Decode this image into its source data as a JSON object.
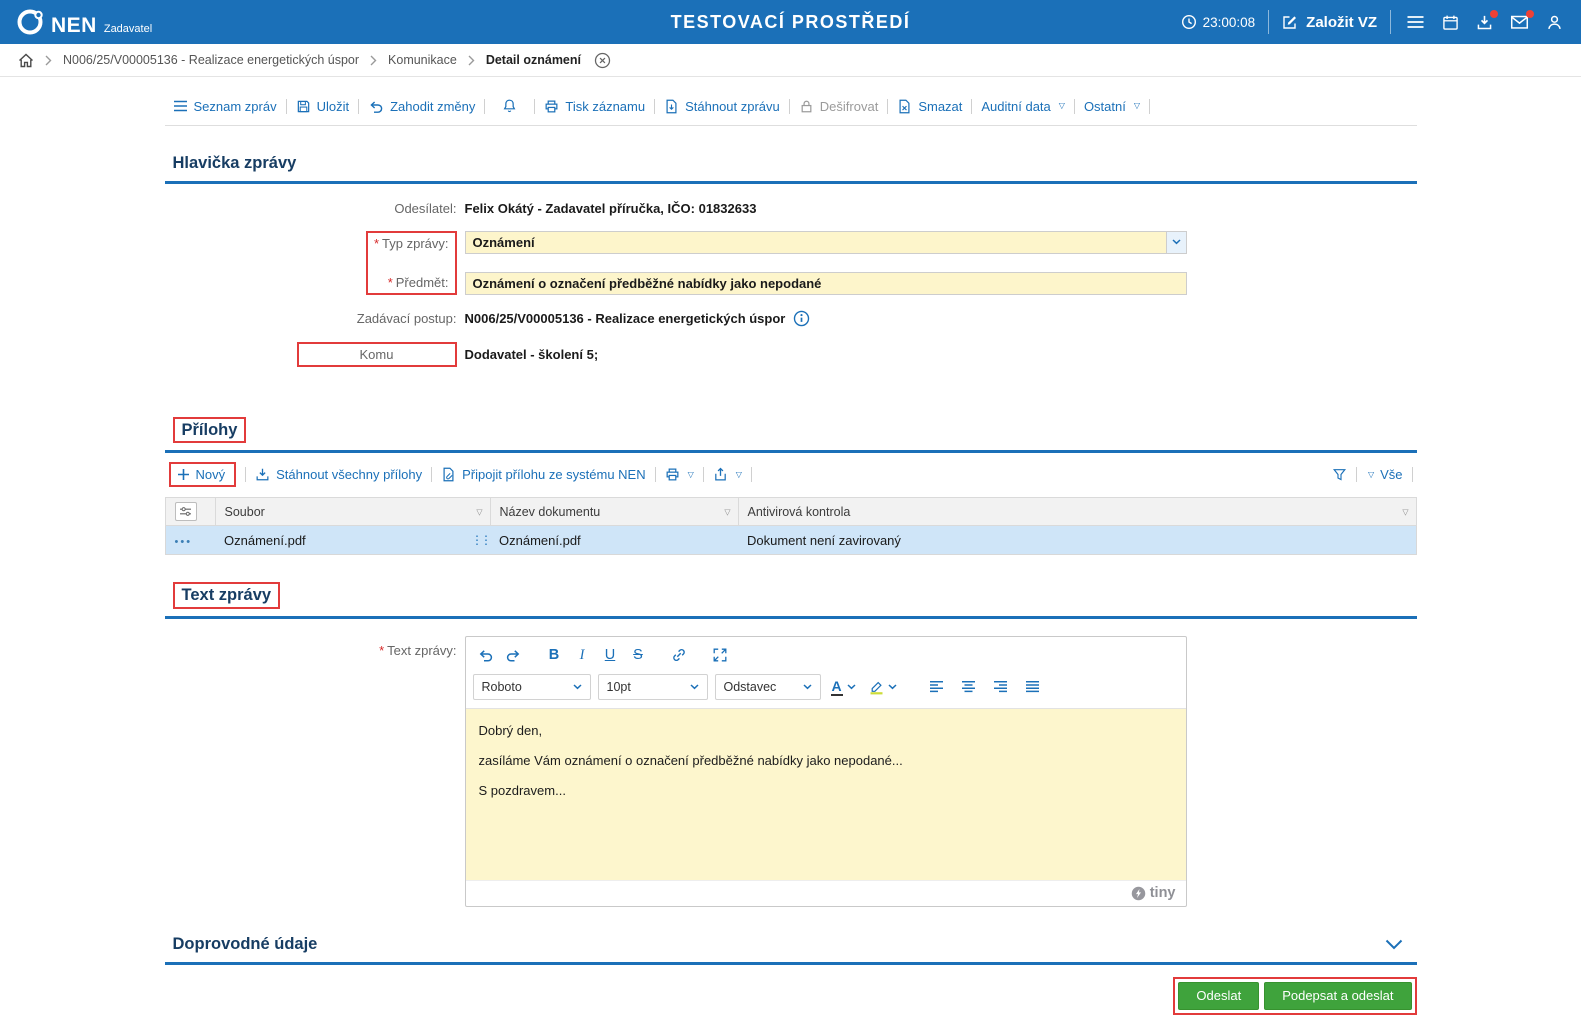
{
  "header": {
    "app_name": "NEN",
    "app_role": "Zadavatel",
    "env_title": "TESTOVACÍ PROSTŘEDÍ",
    "time": "23:00:08",
    "new_vz_label": "Založit VZ"
  },
  "breadcrumb": {
    "items": [
      "N006/25/V00005136 - Realizace energetických úspor",
      "Komunikace",
      "Detail oznámení"
    ]
  },
  "toolbar": {
    "seznam_zprav": "Seznam zpráv",
    "ulozit": "Uložit",
    "zahodit_zmeny": "Zahodit změny",
    "tisk_zaznamu": "Tisk záznamu",
    "stahnout_zpravu": "Stáhnout zprávu",
    "desifrovat": "Dešifrovat",
    "smazat": "Smazat",
    "auditni_data": "Auditní data",
    "ostatni": "Ostatní"
  },
  "required_mark": "*",
  "message_header": {
    "section_title": "Hlavička zprávy",
    "sender_label": "Odesílatel:",
    "sender_value": "Felix Okátý - Zadavatel příručka, IČO: 01832633",
    "type_label": "Typ zprávy:",
    "type_value": "Oznámení",
    "subject_label": "Předmět:",
    "subject_value": "Oznámení o označení předběžné nabídky jako nepodané",
    "procedure_label": "Zadávací postup:",
    "procedure_value": "N006/25/V00005136 - Realizace energetických úspor",
    "to_label": "Komu",
    "to_value": "Dodavatel - školení 5;"
  },
  "attachments": {
    "section_title": "Přílohy",
    "new_label": "Nový",
    "download_all_label": "Stáhnout všechny přílohy",
    "attach_from_nen_label": "Připojit přílohu ze systému NEN",
    "vse_label": "Vše",
    "columns": [
      "Soubor",
      "Název dokumentu",
      "Antivirová kontrola"
    ],
    "rows": [
      {
        "soubor": "Oznámení.pdf",
        "nazev_dokumentu": "Oznámení.pdf",
        "antivirova_kontrola": "Dokument není zavirovaný"
      }
    ]
  },
  "message_text": {
    "section_title": "Text zprávy",
    "field_label": "Text zprávy:",
    "editor": {
      "font_name": "Roboto",
      "font_size": "10pt",
      "block_format": "Odstavec",
      "bold": "B",
      "italic": "I",
      "underline": "U",
      "strikethrough": "S",
      "text_color": "A",
      "paragraphs": [
        "Dobrý den,",
        "zasíláme Vám oznámení o označení předběžné nabídky jako nepodané...",
        "S pozdravem..."
      ],
      "brand": "tiny"
    }
  },
  "additional_section": {
    "section_title": "Doprovodné údaje"
  },
  "actions": {
    "send_label": "Odeslat",
    "sign_and_send_label": "Podepsat a odeslat"
  },
  "icons_text": {
    "triangle_down": "▽",
    "row_dots": "•••",
    "grip": "⋮⋮"
  },
  "colors": {
    "header_blue": "#1b70b8",
    "accent_blue": "#1b70b8",
    "section_title_navy": "#173d63",
    "input_yellow": "#fdf5cb",
    "annotation_red": "#e23b3b",
    "button_green": "#3fa33c",
    "selected_row_blue": "#cfe5f8"
  }
}
